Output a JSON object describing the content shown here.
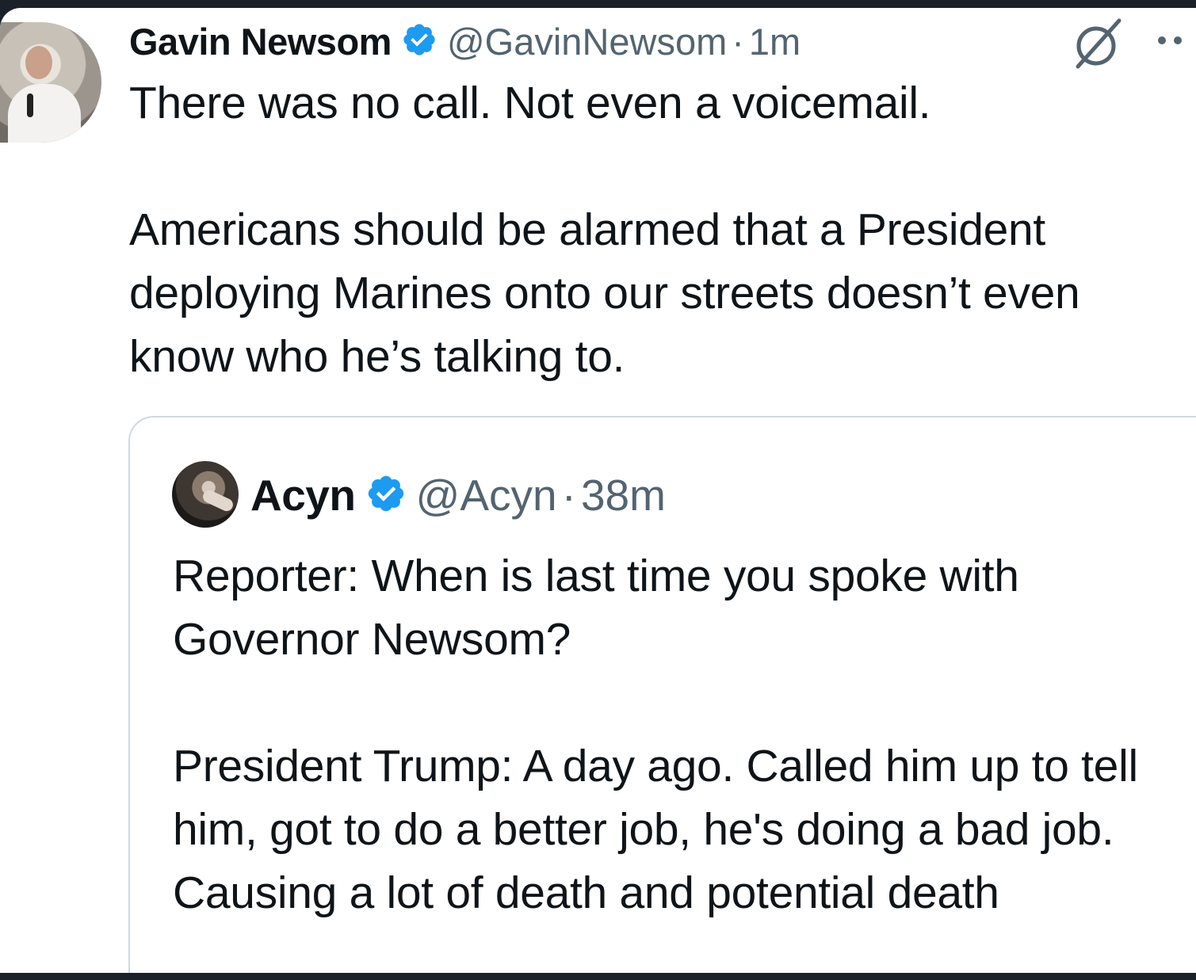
{
  "tweet": {
    "author_name": "Gavin Newsom",
    "handle": "@GavinNewsom",
    "separator": "·",
    "time": "1m",
    "text": "There was no call. Not even a voicemail.\n\nAmericans should be alarmed that a President deploying Marines onto our streets doesn’t even know who he’s talking to.",
    "verified_color": "#1d9bf0",
    "icons": [
      "avatar",
      "verified-badge-icon",
      "grok-icon",
      "more-options-icon"
    ]
  },
  "quoted_tweet": {
    "author_name": "Acyn",
    "handle": "@Acyn",
    "separator": "·",
    "time": "38m",
    "text": "Reporter: When is last time you spoke with Governor Newsom?\n\nPresident Trump: A day ago. Called him up to tell him, got to do a better job, he's doing a bad job. Causing a lot of death and potential death",
    "verified_color": "#1d9bf0"
  },
  "colors": {
    "background_dark": "#1a2129",
    "card": "#ffffff",
    "text_primary": "#0f1419",
    "text_secondary": "#536471",
    "border": "#cfd9de"
  }
}
